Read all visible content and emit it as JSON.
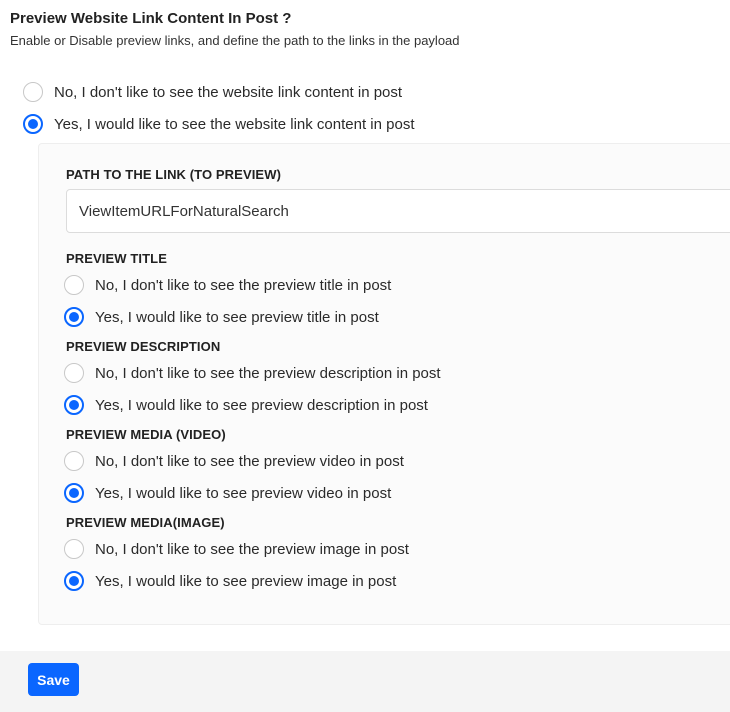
{
  "section": {
    "title": "Preview Website Link Content In Post ?",
    "description": "Enable or Disable preview links, and define the path to the links in the payload"
  },
  "preview_link": {
    "options": [
      {
        "label": "No, I don't like to see the website link content in post",
        "checked": false
      },
      {
        "label": "Yes, I would like to see the website link content in post",
        "checked": true
      }
    ]
  },
  "path": {
    "label": "PATH TO THE LINK (TO PREVIEW)",
    "value": "ViewItemURLForNaturalSearch"
  },
  "preview_title": {
    "label": "PREVIEW TITLE",
    "options": [
      {
        "label": "No, I don't like to see the preview title in post",
        "checked": false
      },
      {
        "label": "Yes, I would like to see preview title in post",
        "checked": true
      }
    ]
  },
  "preview_description": {
    "label": "PREVIEW DESCRIPTION",
    "options": [
      {
        "label": "No, I don't like to see the preview description in post",
        "checked": false
      },
      {
        "label": "Yes, I would like to see preview description in post",
        "checked": true
      }
    ]
  },
  "preview_video": {
    "label": "PREVIEW MEDIA (VIDEO)",
    "options": [
      {
        "label": "No, I don't like to see the preview video in post",
        "checked": false
      },
      {
        "label": "Yes, I would like to see preview video in post",
        "checked": true
      }
    ]
  },
  "preview_image": {
    "label": "PREVIEW MEDIA(IMAGE)",
    "options": [
      {
        "label": "No, I don't like to see the preview image in post",
        "checked": false
      },
      {
        "label": "Yes, I would like to see preview image in post",
        "checked": true
      }
    ]
  },
  "footer": {
    "save_label": "Save"
  },
  "colors": {
    "accent": "#0a66ff",
    "panel_bg": "#fbfbfb",
    "footer_bg": "#f4f4f4"
  }
}
